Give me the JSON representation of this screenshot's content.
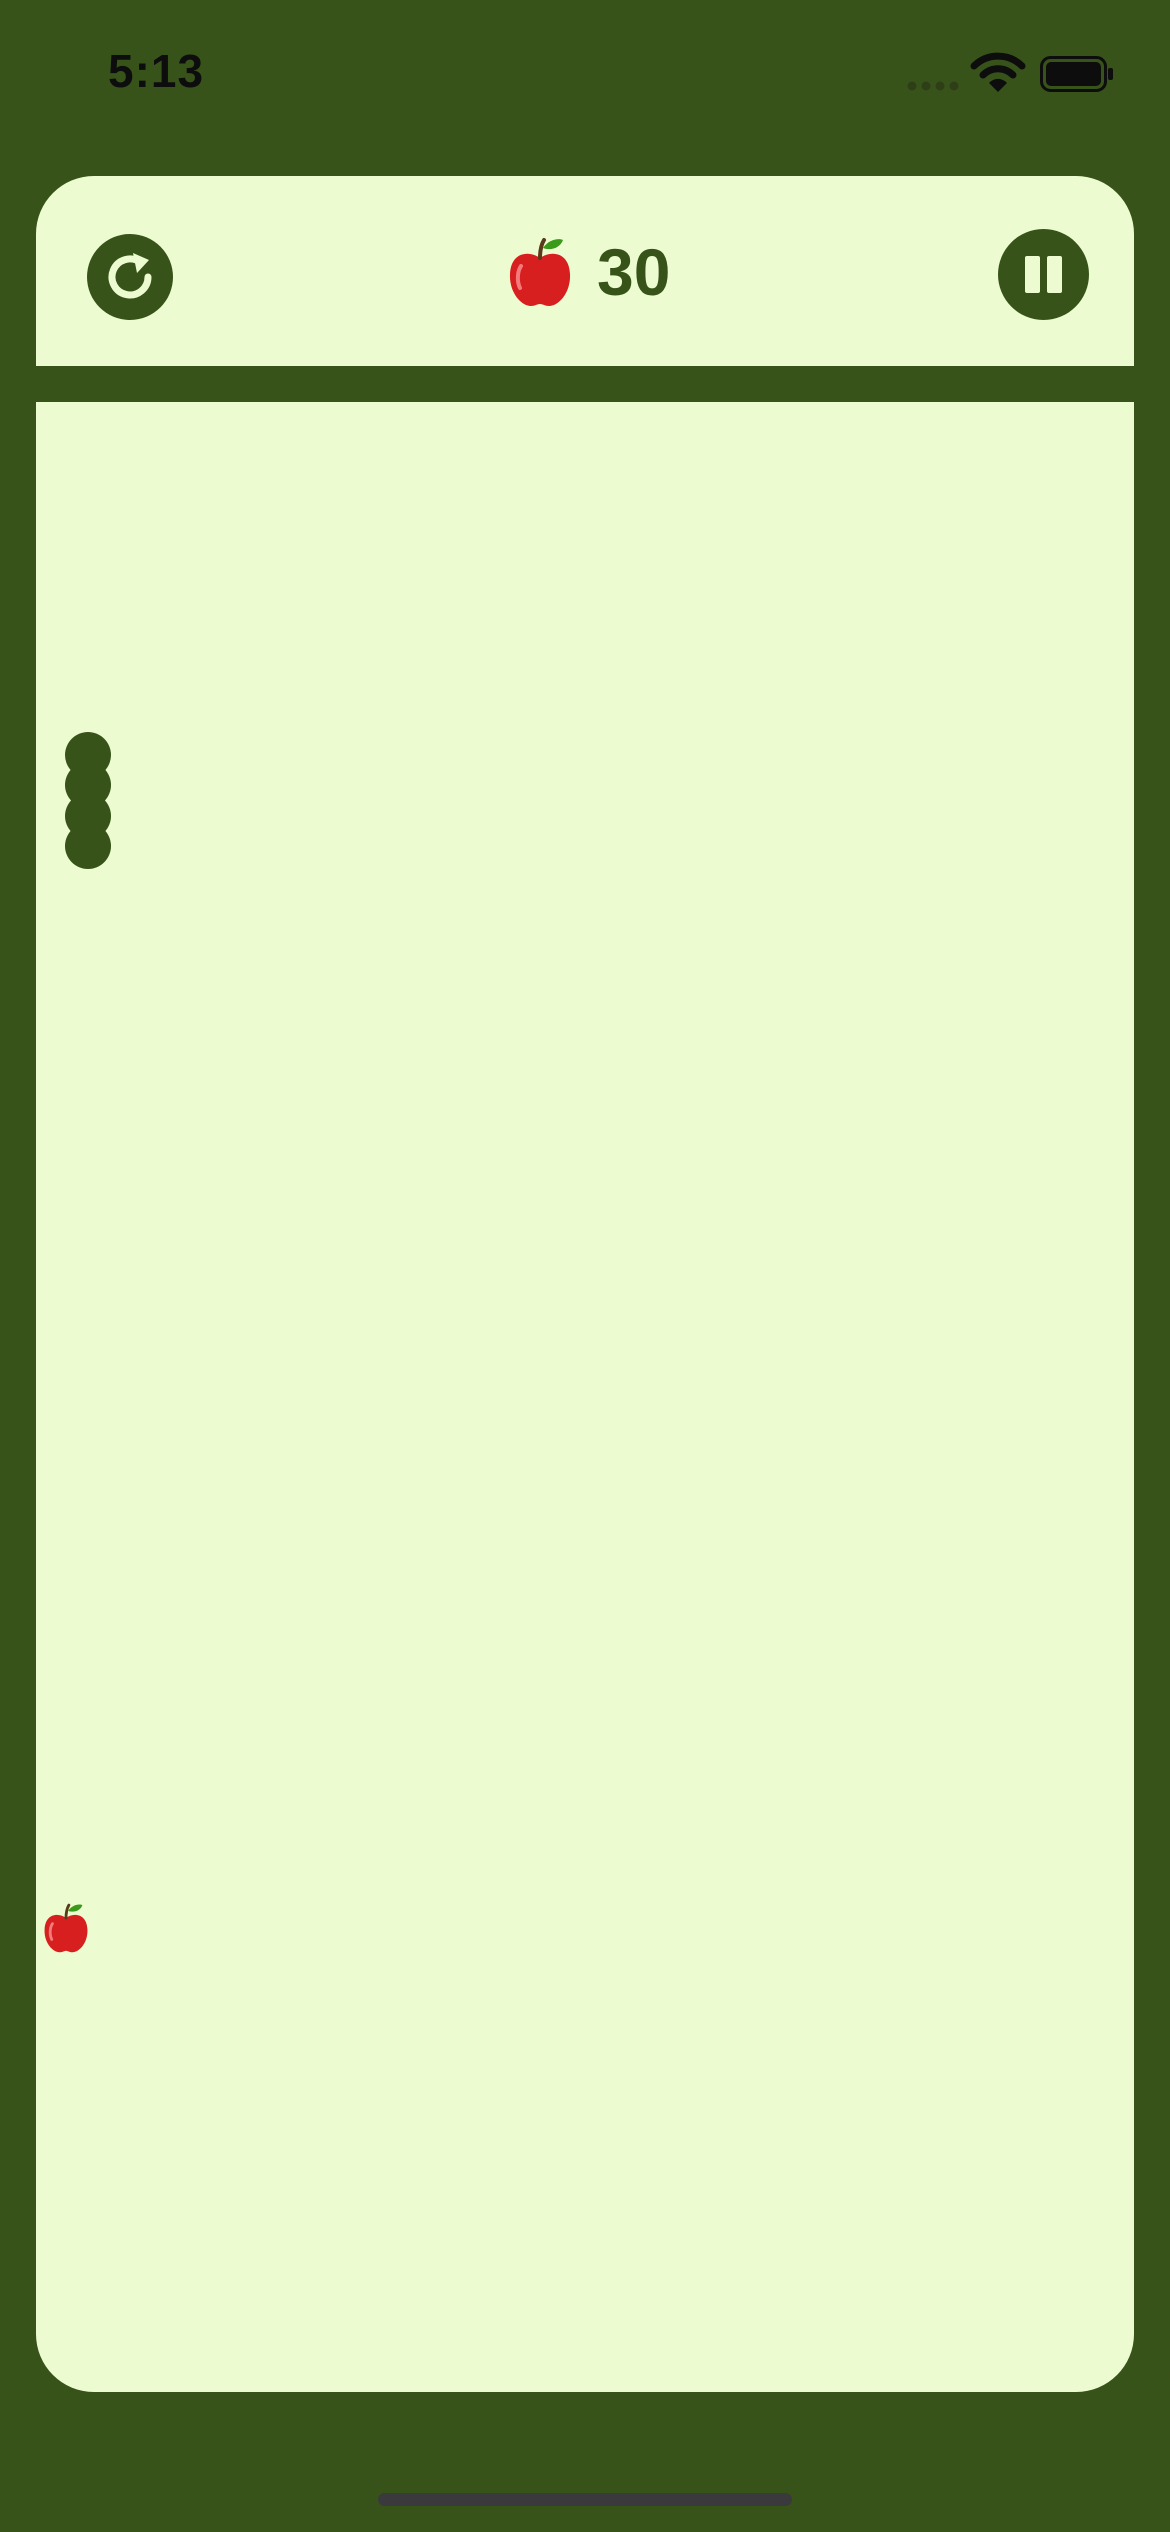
{
  "status_bar": {
    "time": "5:13",
    "signal_icon": "signal-dots-icon",
    "wifi_icon": "wifi-icon",
    "battery_icon": "battery-full-icon"
  },
  "header": {
    "restart_icon": "restart-icon",
    "pause_icon": "pause-icon",
    "score_icon": "apple-icon",
    "score": "30"
  },
  "board": {
    "snake_segments": 4,
    "food_icon": "apple-icon"
  },
  "colors": {
    "frame": "#38531a",
    "board": "#ecfcd0",
    "snake": "#38531a",
    "apple": "#d71f1f"
  }
}
